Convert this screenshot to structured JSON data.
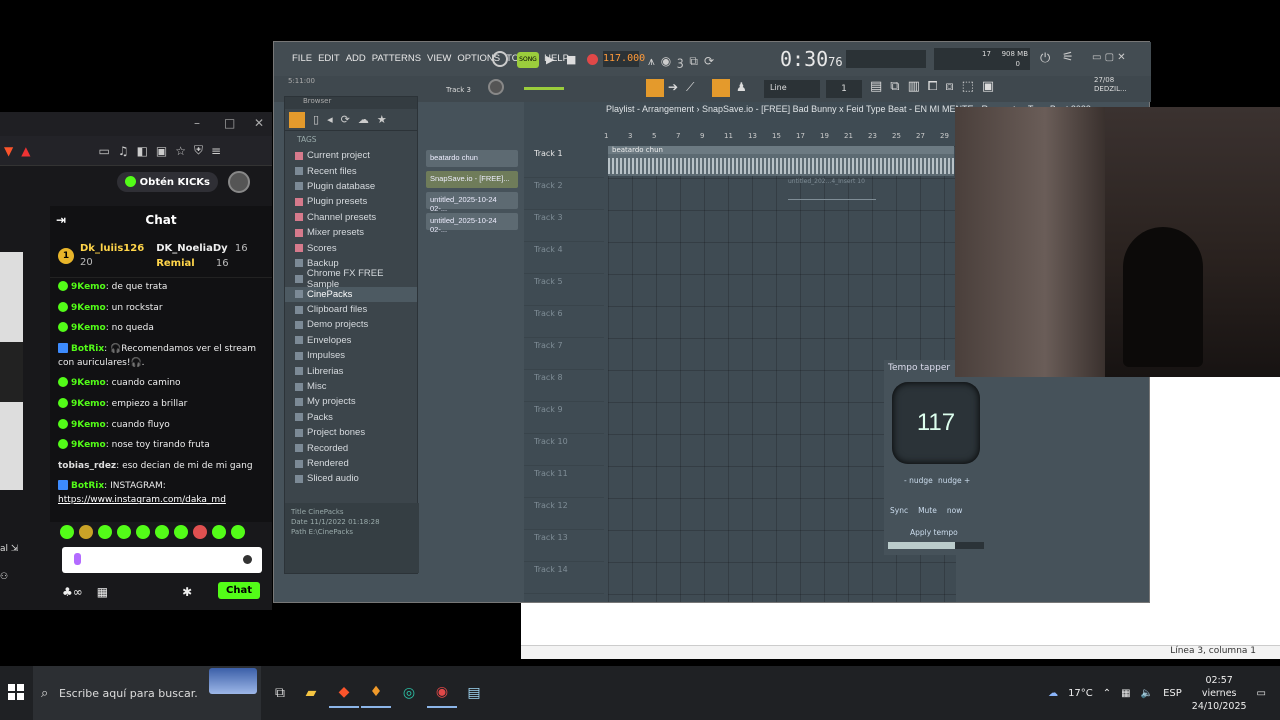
{
  "browser": {
    "kick_button": "Obtén KICKs",
    "chat": {
      "title": "Chat",
      "leaderboard": [
        {
          "rank": "1",
          "name": "Dk_luiis126",
          "count": "20"
        },
        {
          "name": "DK_NoeliaDy",
          "count": "16"
        },
        {
          "name": "Remial",
          "count": "16"
        }
      ],
      "messages": [
        {
          "user": "9Kemo",
          "text": "de que trata",
          "bot": false
        },
        {
          "user": "9Kemo",
          "text": "un rockstar",
          "bot": false
        },
        {
          "user": "9Kemo",
          "text": "no queda",
          "bot": false
        },
        {
          "user": "BotRix",
          "text": "🎧Recomendamos ver el stream con auriculares!🎧.",
          "bot": true
        },
        {
          "user": "9Kemo",
          "text": "cuando camino",
          "bot": false
        },
        {
          "user": "9Kemo",
          "text": "empiezo a brillar",
          "bot": false
        },
        {
          "user": "9Kemo",
          "text": "cuando fluyo",
          "bot": false
        },
        {
          "user": "9Kemo",
          "text": "nose toy tirando fruta",
          "bot": false
        },
        {
          "user": "tobias_rdez",
          "text": "eso decian de mi de mi gang",
          "bot": false
        },
        {
          "user": "BotRix",
          "text": "INSTAGRAM:",
          "bot": true
        }
      ],
      "instagram_link": "https://www.instagram.com/daka_md",
      "send_label": "Chat"
    }
  },
  "fl": {
    "menu": [
      "FILE",
      "EDIT",
      "ADD",
      "PATTERNS",
      "VIEW",
      "OPTIONS",
      "TOOLS",
      "HELP"
    ],
    "tempo": "117.000",
    "time": "0:30",
    "time_ms": "76",
    "snap": "Line",
    "browser_title": "Browser",
    "tags_label": "TAGS",
    "tree": [
      "Current project",
      "Recent files",
      "Plugin database",
      "Plugin presets",
      "Channel presets",
      "Mixer presets",
      "Scores",
      "Backup",
      "Chrome FX FREE Sample",
      "CinePacks",
      "Clipboard files",
      "Demo projects",
      "Envelopes",
      "Impulses",
      "Librerias",
      "Misc",
      "My projects",
      "Packs",
      "Project bones",
      "Recorded",
      "Rendered",
      "Sliced audio"
    ],
    "file_info": {
      "title": "CinePacks",
      "date": "11/1/2022 01:18:28",
      "path": "E:\\CinePacks"
    },
    "patterns": [
      "beatardo chun",
      "SnapSave.io - [FREE]...",
      "untitled_2025-10-24 02-...",
      "untitled_2025-10-24 02-..."
    ],
    "playlist_title": "Playlist - Arrangement › SnapSave.io - [FREE] Bad Bunny x Feid Type Beat - EN MI MENTE - Reggaeton Type Beat 2023",
    "ruler": [
      "1",
      "3",
      "5",
      "7",
      "9",
      "11",
      "13",
      "15",
      "17",
      "19",
      "21",
      "23",
      "25",
      "27",
      "29"
    ],
    "tracks": [
      "Track 1",
      "Track 2",
      "Track 3",
      "Track 4",
      "Track 5",
      "Track 6",
      "Track 7",
      "Track 8",
      "Track 9",
      "Track 10",
      "Track 11",
      "Track 12",
      "Track 13",
      "Track 14"
    ],
    "clip_name": "beatardo chun",
    "ghost_clip": "untitled_202...4_Insert 10",
    "current_track_hint": "Track 3",
    "pos_hint": "5:11:00",
    "meter_right": "908 MB",
    "meter_num": "17",
    "meter_zero": "0",
    "news": "27/08 DEDZIL..."
  },
  "tapper": {
    "title": "Tempo tapper",
    "bpm": "117",
    "nudge_minus": "- nudge",
    "nudge_plus": "nudge +",
    "sync": "Sync",
    "mute": "Mute",
    "now": "now",
    "apply": "Apply tempo",
    "level": 0.7
  },
  "notepad": {
    "status": "Línea 3, columna 1"
  },
  "taskbar": {
    "search": "Escribe aquí para buscar.",
    "temp": "17°C",
    "lang": "ESP",
    "time": "02:57",
    "day": "viernes",
    "date": "24/10/2025"
  }
}
